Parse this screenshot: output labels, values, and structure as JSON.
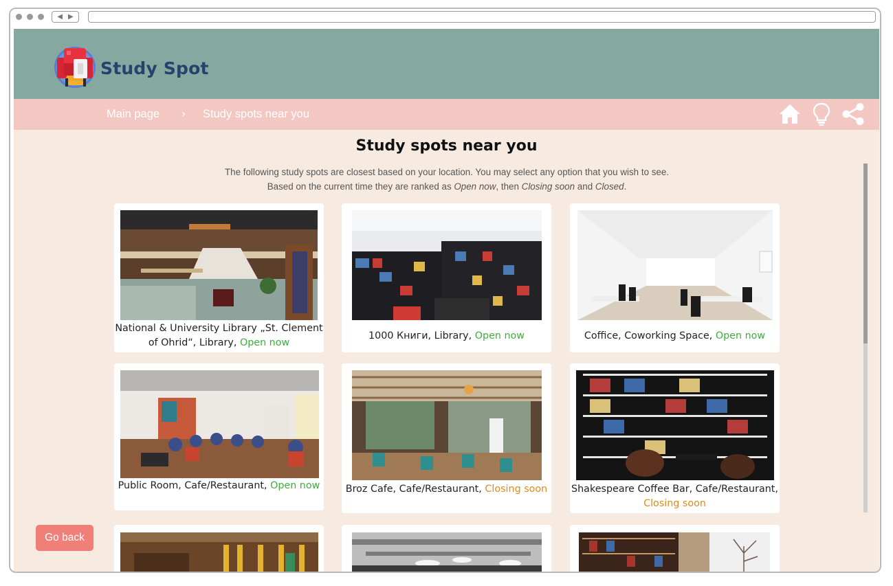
{
  "app": {
    "brand": "Study Spot"
  },
  "breadcrumb": {
    "home": "Main page",
    "separator": "›",
    "current": "Study spots near you"
  },
  "nav_icons": [
    "home-icon",
    "lightbulb-icon",
    "share-icon"
  ],
  "page": {
    "title": "Study spots near you",
    "intro_part1": "The following study spots are closest based on your location. You may select any option that you wish to see. Based on the current time they are ranked as ",
    "intro_open": "Open now",
    "intro_part2": ", then ",
    "intro_soon": "Closing soon",
    "intro_part3": " and ",
    "intro_closed": "Closed",
    "intro_end": "."
  },
  "cards": [
    {
      "name": "National & University Library „St. Clement of Ohrid“, Library, ",
      "status": "Open now",
      "status_type": "open"
    },
    {
      "name": "1000 Книги, Library, ",
      "status": "Open now",
      "status_type": "open"
    },
    {
      "name": "Coffice, Coworking Space, ",
      "status": "Open now",
      "status_type": "open"
    },
    {
      "name": "Public Room, Cafe/Restaurant, ",
      "status": "Open now",
      "status_type": "open"
    },
    {
      "name": "Broz Cafe, Cafe/Restaurant, ",
      "status": "Closing soon",
      "status_type": "soon"
    },
    {
      "name": "Shakespeare Coffee Bar, Cafe/Restaurant, ",
      "status": "Closing soon",
      "status_type": "soon"
    }
  ],
  "colors": {
    "header": "#85a8a0",
    "breadcrumb_bar": "#f4c8c2",
    "background": "#f7ebe1",
    "open": "#3fae3f",
    "closing_soon": "#e08a1e",
    "back_button": "#ef7f78",
    "brand": "#27426d"
  },
  "buttons": {
    "back": "Go back"
  }
}
